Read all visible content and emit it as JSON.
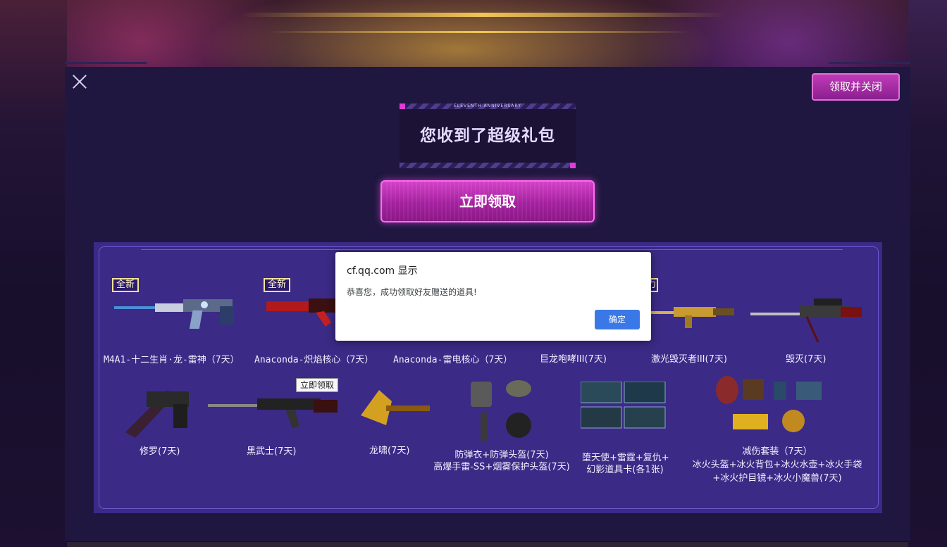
{
  "close_button": {
    "icon": "close-icon"
  },
  "header": {
    "claim_and_close": "领取并关闭"
  },
  "title_banner": {
    "tagline": "ELEVENTH ANNIVERSARY",
    "title": "您收到了超级礼包"
  },
  "claim_button": {
    "label": "立即领取"
  },
  "badges": {
    "new": "全新",
    "power": "强力"
  },
  "items_row1": [
    {
      "label": "M4A1-十二生肖·龙-雷神（7天）"
    },
    {
      "label": "Anaconda-炽焰核心（7天）"
    },
    {
      "label": "Anaconda-雷电核心（7天）"
    },
    {
      "label": "巨龙咆哮III(7天)"
    },
    {
      "label": "激光毁灭者III(7天)"
    },
    {
      "label": "毁灭(7天)"
    }
  ],
  "items_row2": [
    {
      "label": "修罗(7天)"
    },
    {
      "label": "黑武士(7天)"
    },
    {
      "label": "龙啸(7天)"
    },
    {
      "label_line1": "防弹衣+防弹头盔(7天)",
      "label_line2": "高爆手雷-SS+烟雾保护头盔(7天)"
    },
    {
      "label_line1": "堕天使+雷霆+复仇+",
      "label_line2": "幻影道具卡(各1张)"
    },
    {
      "label_line1": "减伤套装（7天）",
      "label_line2": "冰火头盔+冰火背包+冰火水壶+冰火手袋",
      "label_line3": "+冰火护目镜+冰火小魔兽(7天)"
    }
  ],
  "tooltip": {
    "text": "立即领取"
  },
  "dialog": {
    "title": "cf.qq.com 显示",
    "message": "恭喜您，成功领取好友赠送的道具!",
    "ok_label": "确定"
  },
  "colors": {
    "accent_pink": "#c13ab8",
    "panel": "#3b2a86",
    "modal": "#1f1740",
    "dialog_button": "#3b78e7"
  }
}
